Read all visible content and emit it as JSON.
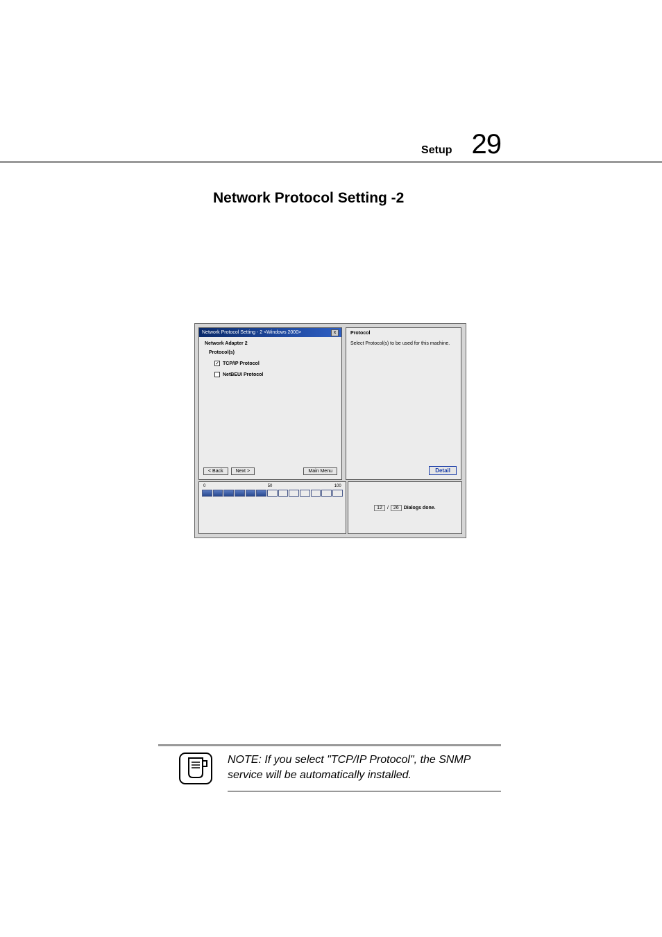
{
  "header": {
    "section_label": "Setup",
    "page_number": "29"
  },
  "section_title": "Network Protocol Setting -2",
  "dialog": {
    "title": "Network Protocol Setting - 2 <Windows 2000>",
    "adapter_label": "Network Adapter 2",
    "protocols_label": "Protocol(s)",
    "protocol_tcpip": {
      "label": "TCP/IP Protocol",
      "checked": true
    },
    "protocol_netbeui": {
      "label": "NetBEUI Protocol",
      "checked": false
    },
    "buttons": {
      "back": "< Back",
      "next": "Next >",
      "main_menu": "Main Menu"
    },
    "side": {
      "heading": "Protocol",
      "desc": "Select Protocol(s) to be used for this machine.",
      "detail": "Detail"
    },
    "progress": {
      "scale_min": "0",
      "scale_mid": "50",
      "scale_max": "100",
      "done": "12",
      "sep": "/",
      "total": "26",
      "status": "Dialogs done."
    }
  },
  "note": {
    "text": "NOTE: If you select \"TCP/IP Protocol\", the SNMP service will be automatically installed."
  }
}
